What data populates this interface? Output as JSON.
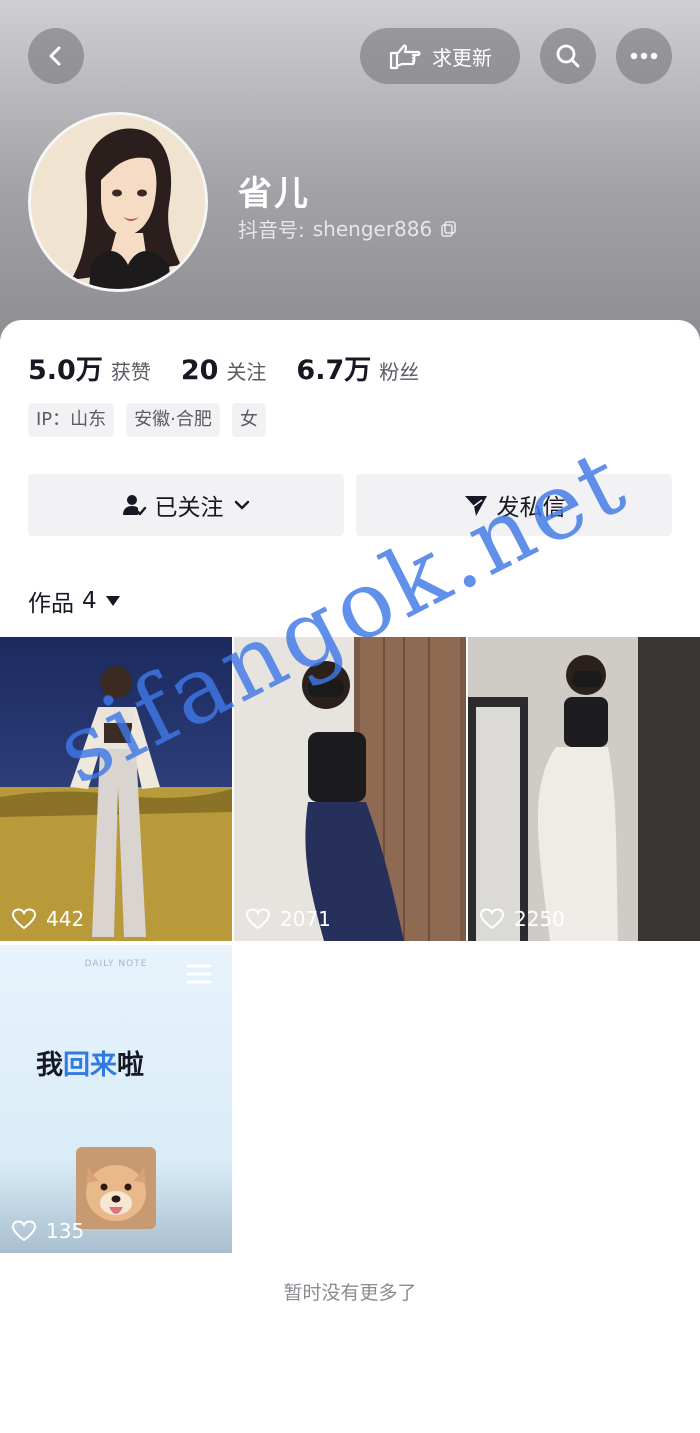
{
  "header": {
    "update_label": "求更新",
    "name": "省儿",
    "douyin_id_label": "抖音号:",
    "douyin_id": "shenger886"
  },
  "stats": [
    {
      "value": "5.0万",
      "label": "获赞"
    },
    {
      "value": "20",
      "label": "关注"
    },
    {
      "value": "6.7万",
      "label": "粉丝"
    }
  ],
  "tags": [
    "IP：山东",
    "安徽·合肥",
    "女"
  ],
  "actions": {
    "follow_label": "已关注",
    "message_label": "发私信"
  },
  "works": {
    "label": "作品",
    "count": "4"
  },
  "videos": [
    {
      "likes": "442"
    },
    {
      "likes": "2071"
    },
    {
      "likes": "2250"
    },
    {
      "likes": "135",
      "caption_a": "我",
      "caption_b": "回来",
      "caption_c": "啦",
      "small_text": "DAILY NOTE"
    }
  ],
  "footer": {
    "no_more": "暂时没有更多了"
  },
  "watermark": "sifangok.net",
  "colors": {
    "accent_blue": "#2f7be0",
    "watermark": "#3e78e6"
  }
}
